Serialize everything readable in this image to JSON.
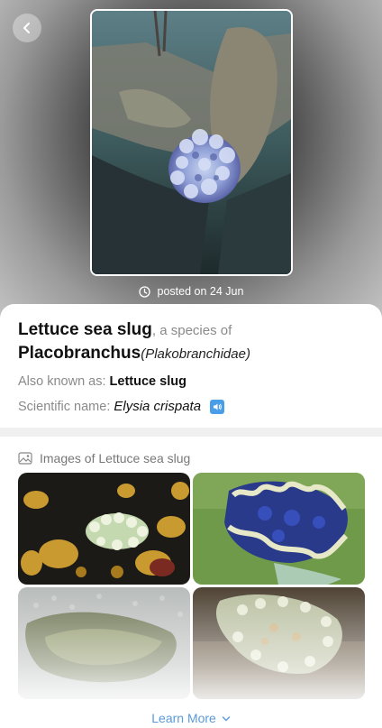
{
  "hero": {
    "posted_text": "posted on 24 Jun",
    "back_icon": "chevron-left-icon",
    "clock_icon": "clock-icon"
  },
  "species": {
    "common_name": "Lettuce sea slug",
    "species_of_text": ", a species of",
    "genus": "Placobranchus",
    "family": "(Plakobranchidae)",
    "aka_label": "Also known as:",
    "aka_value": "Lettuce slug",
    "sci_label": "Scientific name:",
    "sci_value": "Elysia crispata",
    "speaker_icon": "speaker-icon"
  },
  "images_section": {
    "title": "Images of Lettuce sea slug",
    "icon": "image-icon",
    "learn_more": "Learn More"
  },
  "colors": {
    "accent": "#5a9ad8",
    "speaker": "#4a9ee8"
  }
}
